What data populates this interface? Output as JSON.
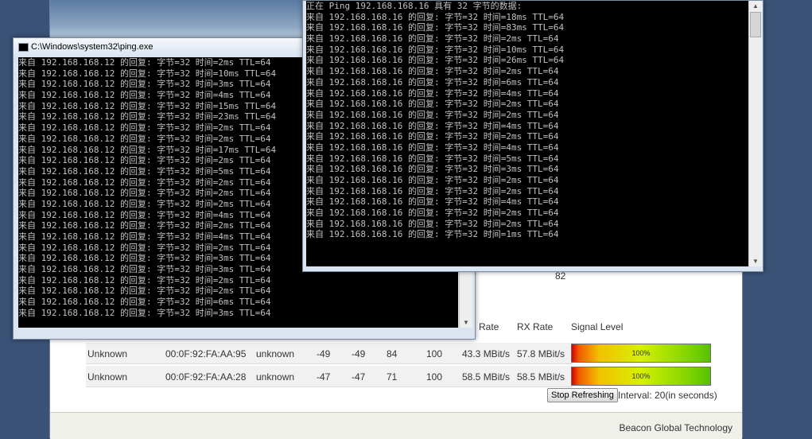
{
  "ping1": {
    "title": "C:\\Windows\\system32\\ping.exe",
    "lines": [
      "来自 192.168.168.12 的回复: 字节=32 时间=2ms TTL=64",
      "来自 192.168.168.12 的回复: 字节=32 时间=10ms TTL=64",
      "来自 192.168.168.12 的回复: 字节=32 时间=3ms TTL=64",
      "来自 192.168.168.12 的回复: 字节=32 时间=4ms TTL=64",
      "来自 192.168.168.12 的回复: 字节=32 时间=15ms TTL=64",
      "来自 192.168.168.12 的回复: 字节=32 时间=23ms TTL=64",
      "来自 192.168.168.12 的回复: 字节=32 时间=2ms TTL=64",
      "来自 192.168.168.12 的回复: 字节=32 时间=2ms TTL=64",
      "来自 192.168.168.12 的回复: 字节=32 时间=17ms TTL=64",
      "来自 192.168.168.12 的回复: 字节=32 时间=2ms TTL=64",
      "来自 192.168.168.12 的回复: 字节=32 时间=5ms TTL=64",
      "来自 192.168.168.12 的回复: 字节=32 时间=2ms TTL=64",
      "来自 192.168.168.12 的回复: 字节=32 时间=2ms TTL=64",
      "来自 192.168.168.12 的回复: 字节=32 时间=2ms TTL=64",
      "来自 192.168.168.12 的回复: 字节=32 时间=4ms TTL=64",
      "来自 192.168.168.12 的回复: 字节=32 时间=2ms TTL=64",
      "来自 192.168.168.12 的回复: 字节=32 时间=4ms TTL=64",
      "来自 192.168.168.12 的回复: 字节=32 时间=2ms TTL=64",
      "来自 192.168.168.12 的回复: 字节=32 时间=3ms TTL=64",
      "来自 192.168.168.12 的回复: 字节=32 时间=3ms TTL=64",
      "来自 192.168.168.12 的回复: 字节=32 时间=2ms TTL=64",
      "来自 192.168.168.12 的回复: 字节=32 时间=2ms TTL=64",
      "来自 192.168.168.12 的回复: 字节=32 时间=6ms TTL=64",
      "来自 192.168.168.12 的回复: 字节=32 时间=3ms TTL=64"
    ]
  },
  "ping2": {
    "lines": [
      "正在 Ping 192.168.168.16 具有 32 字节的数据:",
      "来自 192.168.168.16 的回复: 字节=32 时间=18ms TTL=64",
      "来自 192.168.168.16 的回复: 字节=32 时间=83ms TTL=64",
      "来自 192.168.168.16 的回复: 字节=32 时间=2ms TTL=64",
      "来自 192.168.168.16 的回复: 字节=32 时间=10ms TTL=64",
      "来自 192.168.168.16 的回复: 字节=32 时间=26ms TTL=64",
      "来自 192.168.168.16 的回复: 字节=32 时间=2ms TTL=64",
      "来自 192.168.168.16 的回复: 字节=32 时间=6ms TTL=64",
      "来自 192.168.168.16 的回复: 字节=32 时间=4ms TTL=64",
      "来自 192.168.168.16 的回复: 字节=32 时间=2ms TTL=64",
      "来自 192.168.168.16 的回复: 字节=32 时间=2ms TTL=64",
      "来自 192.168.168.16 的回复: 字节=32 时间=4ms TTL=64",
      "来自 192.168.168.16 的回复: 字节=32 时间=2ms TTL=64",
      "来自 192.168.168.16 的回复: 字节=32 时间=4ms TTL=64",
      "来自 192.168.168.16 的回复: 字节=32 时间=5ms TTL=64",
      "来自 192.168.168.16 的回复: 字节=32 时间=3ms TTL=64",
      "来自 192.168.168.16 的回复: 字节=32 时间=2ms TTL=64",
      "来自 192.168.168.16 的回复: 字节=32 时间=2ms TTL=64",
      "来自 192.168.168.16 的回复: 字节=32 时间=4ms TTL=64",
      "来自 192.168.168.16 的回复: 字节=32 时间=2ms TTL=64",
      "来自 192.168.168.16 的回复: 字节=32 时间=2ms TTL=64",
      "来自 192.168.168.16 的回复: 字节=32 时间=1ms TTL=64"
    ]
  },
  "webpage": {
    "partial_value": "82",
    "headers": {
      "tx_rate": "Rate",
      "rx_rate": "RX Rate",
      "signal": "Signal Level"
    },
    "rows": [
      {
        "name": "Unknown",
        "mac": "00:0F:92:FA:AA:95",
        "vendor": "unknown",
        "v1": "-49",
        "v2": "-49",
        "v3": "84",
        "v4": "100",
        "tx": "43.3 MBit/s",
        "rx": "57.8 MBit/s",
        "signal": "100%",
        "signal_level": 1.0
      },
      {
        "name": "Unknown",
        "mac": "00:0F:92:FA:AA:28",
        "vendor": "unknown",
        "v1": "-47",
        "v2": "-47",
        "v3": "71",
        "v4": "100",
        "tx": "58.5 MBit/s",
        "rx": "58.5 MBit/s",
        "signal": "100%",
        "signal_level": 1.0
      }
    ],
    "stop_button": "Stop Refreshing",
    "interval": "Interval: 20(in seconds)",
    "footer": "Beacon Global Technology"
  }
}
